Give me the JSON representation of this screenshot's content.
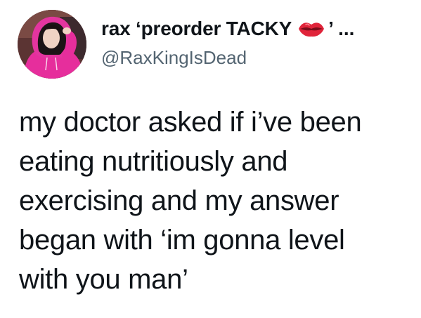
{
  "tweet": {
    "display_name": "rax ‘preorder TACKY",
    "name_suffix": "’ ...",
    "name_emoji": "kiss-lips-icon",
    "handle": "@RaxKingIsDead",
    "body_lines": [
      "my doctor asked if i’ve been",
      "eating nutritiously and",
      "exercising and my answer",
      "began with ‘im gonna level",
      "with you man’"
    ]
  },
  "colors": {
    "text": "#0f1419",
    "handle": "#536471",
    "lips": "#e0243a",
    "avatar_hoodie": "#e62e9c"
  }
}
